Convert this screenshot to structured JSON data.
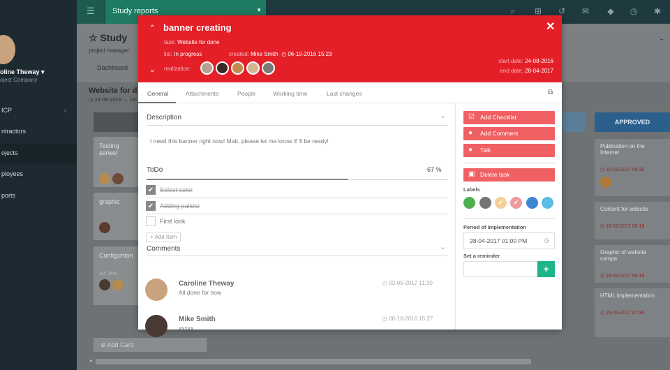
{
  "app": {
    "topbar_tab": "Study reports",
    "page_title": "Study",
    "project_manager_label": "project manager:",
    "dashboard_tab": "Dashboard",
    "list_title": "Website for d",
    "list_dates": "24-08-2016 → 19-",
    "add_card": "Add Card"
  },
  "sidebar": {
    "user_name": "oline Theway",
    "company": "oject Company",
    "items": [
      {
        "label": "ICP"
      },
      {
        "label": "ntractors"
      },
      {
        "label": "ojects"
      },
      {
        "label": "ployees"
      },
      {
        "label": "ports"
      }
    ]
  },
  "columns": {
    "left_cards": [
      {
        "title": "Testing serwer"
      },
      {
        "title": "graphic"
      },
      {
        "title": "Configurtion",
        "sub": "3/4 75%"
      }
    ],
    "approved_header": "APPROVED",
    "approved_cards": [
      {
        "title": "Publication on the Internet",
        "date": "16-03-2017 00:30"
      },
      {
        "title": "Content for website",
        "date": "15-03-2017 00:15"
      },
      {
        "title": "Graphic of website compa",
        "date": "16-03-2017 00:15"
      },
      {
        "title": "HTML implementation",
        "date": "23-03-2017 07:30"
      }
    ]
  },
  "modal": {
    "title": "banner creating",
    "task_label": "task:",
    "task_value": "Website for done",
    "list_label": "list:",
    "list_value": "In progress",
    "created_label": "created:",
    "created_by": "Mike Smith",
    "created_at": "06-10-2016 15:23",
    "realization_label": "realization:",
    "start_label": "start date:",
    "start_date": "24-08-2016",
    "end_label": "end date:",
    "end_date": "28-04-2017",
    "tabs": [
      "General",
      "Attachments",
      "People",
      "Working time",
      "Last changes"
    ],
    "description_title": "Description",
    "description_text": "I need this banner right now! Matt, please let me know if 'll be ready!",
    "todo_title": "ToDo",
    "todo_percent": "67 %",
    "todo_progress": 0.67,
    "todo_items": [
      {
        "label": "Select color",
        "done": true
      },
      {
        "label": "Adding pallete",
        "done": true
      },
      {
        "label": "First look",
        "done": false
      }
    ],
    "add_item": "Add Item",
    "comments_title": "Comments",
    "comments": [
      {
        "author": "Caroline Theway",
        "text": "All done for now",
        "time": "02-05-2017 11:30"
      },
      {
        "author": "Mike Smith",
        "text": "xxxxx",
        "time": "06-10-2016 15:27"
      }
    ],
    "actions": {
      "add_checklist": "Add Checklist",
      "add_comment": "Add Comment",
      "talk": "Talk",
      "delete_task": "Delete task"
    },
    "labels_title": "Labels",
    "label_colors": [
      "#4caf50",
      "#757575",
      "#f5cf9a",
      "#ec9a9a",
      "#3d86d1",
      "#5bbce4"
    ],
    "period_title": "Period of implementation",
    "period_value": "28-04-2017 01:00 PM",
    "reminder_title": "Set a reminder"
  }
}
